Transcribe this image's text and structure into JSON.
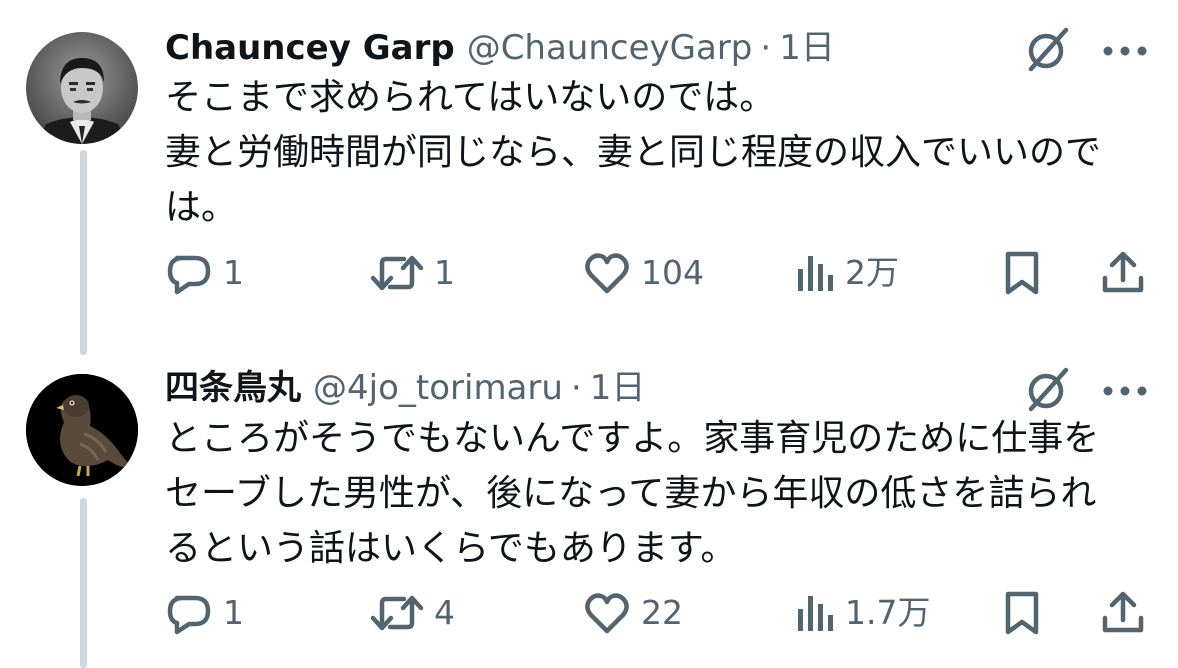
{
  "tweets": [
    {
      "name": "Chauncey Garp",
      "handle": "@ChaunceyGarp",
      "separator": "·",
      "time": "1日",
      "text": "そこまで求められてはいないのでは。\n妻と労働時間が同じなら、妻と同じ程度の収入でいいので\nは。",
      "replies": "1",
      "retweets": "1",
      "likes": "104",
      "views": "2万"
    },
    {
      "name": "四条鳥丸",
      "handle": "@4jo_torimaru",
      "separator": "·",
      "time": "1日",
      "text": "ところがそうでもないんですよ。家事育児のために仕事を\nセーブした男性が、後になって妻から年収の低さを詰られ\nるという話はいくらでもあります。",
      "replies": "1",
      "retweets": "4",
      "likes": "22",
      "views": "1.7万"
    }
  ],
  "icons": {
    "reply": "reply-icon",
    "retweet": "retweet-icon",
    "like": "heart-icon",
    "views": "views-icon",
    "bookmark": "bookmark-icon",
    "share": "share-icon",
    "grok": "grok-icon",
    "more": "more-icon"
  },
  "colors": {
    "text": "#0f1419",
    "secondary": "#536471",
    "thread_line": "#cfd9de"
  }
}
